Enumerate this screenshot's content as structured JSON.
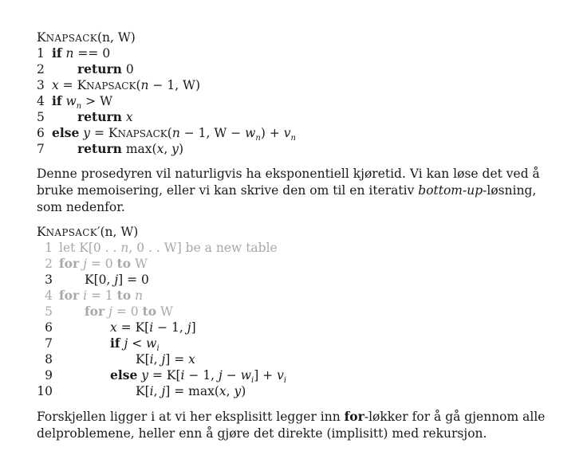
{
  "algo1": {
    "title_cap": "K",
    "title_sc": "NAPSACK",
    "title_args": "(n, W)",
    "lines": [
      {
        "num": "1",
        "text": "if n == 0"
      },
      {
        "num": "2",
        "text": "return 0"
      },
      {
        "num": "3",
        "text": "x = KNAPSACK(n − 1, W)"
      },
      {
        "num": "4",
        "text": "if wn > W"
      },
      {
        "num": "5",
        "text": "return x"
      },
      {
        "num": "6",
        "text": "else y = KNAPSACK(n − 1, W − wn) + vn"
      },
      {
        "num": "7",
        "text": "return max(x, y)"
      }
    ]
  },
  "paragraph1": "Denne prosedyren vil naturligvis ha eksponentiell kjøretid. Vi kan løse det ved å bruke memoisering, eller vi kan skrive den om til en iterativ bottom-up-løsning, som nedenfor.",
  "algo2": {
    "title_cap": "K",
    "title_sc": "NAPSACK",
    "title_args": "′(n, W)",
    "lines": [
      {
        "num": "1",
        "text": "let K[0 . . n, 0 . . W] be a new table",
        "faded": true
      },
      {
        "num": "2",
        "text": "for j = 0 to W",
        "faded": true
      },
      {
        "num": "3",
        "text": "K[0, j] = 0",
        "faded": false
      },
      {
        "num": "4",
        "text": "for i = 1 to n",
        "faded": true
      },
      {
        "num": "5",
        "text": "for j = 0 to W",
        "faded": true
      },
      {
        "num": "6",
        "text": "x = K[i − 1, j]",
        "faded": false
      },
      {
        "num": "7",
        "text": "if j < wi",
        "faded": false
      },
      {
        "num": "8",
        "text": "K[i, j] = x",
        "faded": false
      },
      {
        "num": "9",
        "text": "else y = K[i − 1, j − wi] + vi",
        "faded": false
      },
      {
        "num": "10",
        "text": "K[i, j] = max(x, y)",
        "faded": false
      }
    ]
  },
  "paragraph2": "Forskjellen ligger i at vi her eksplisitt legger inn for-løkker for å gå gjennom alle delproblemene, heller enn å gjøre det direkte (implisitt) med rekursjon."
}
